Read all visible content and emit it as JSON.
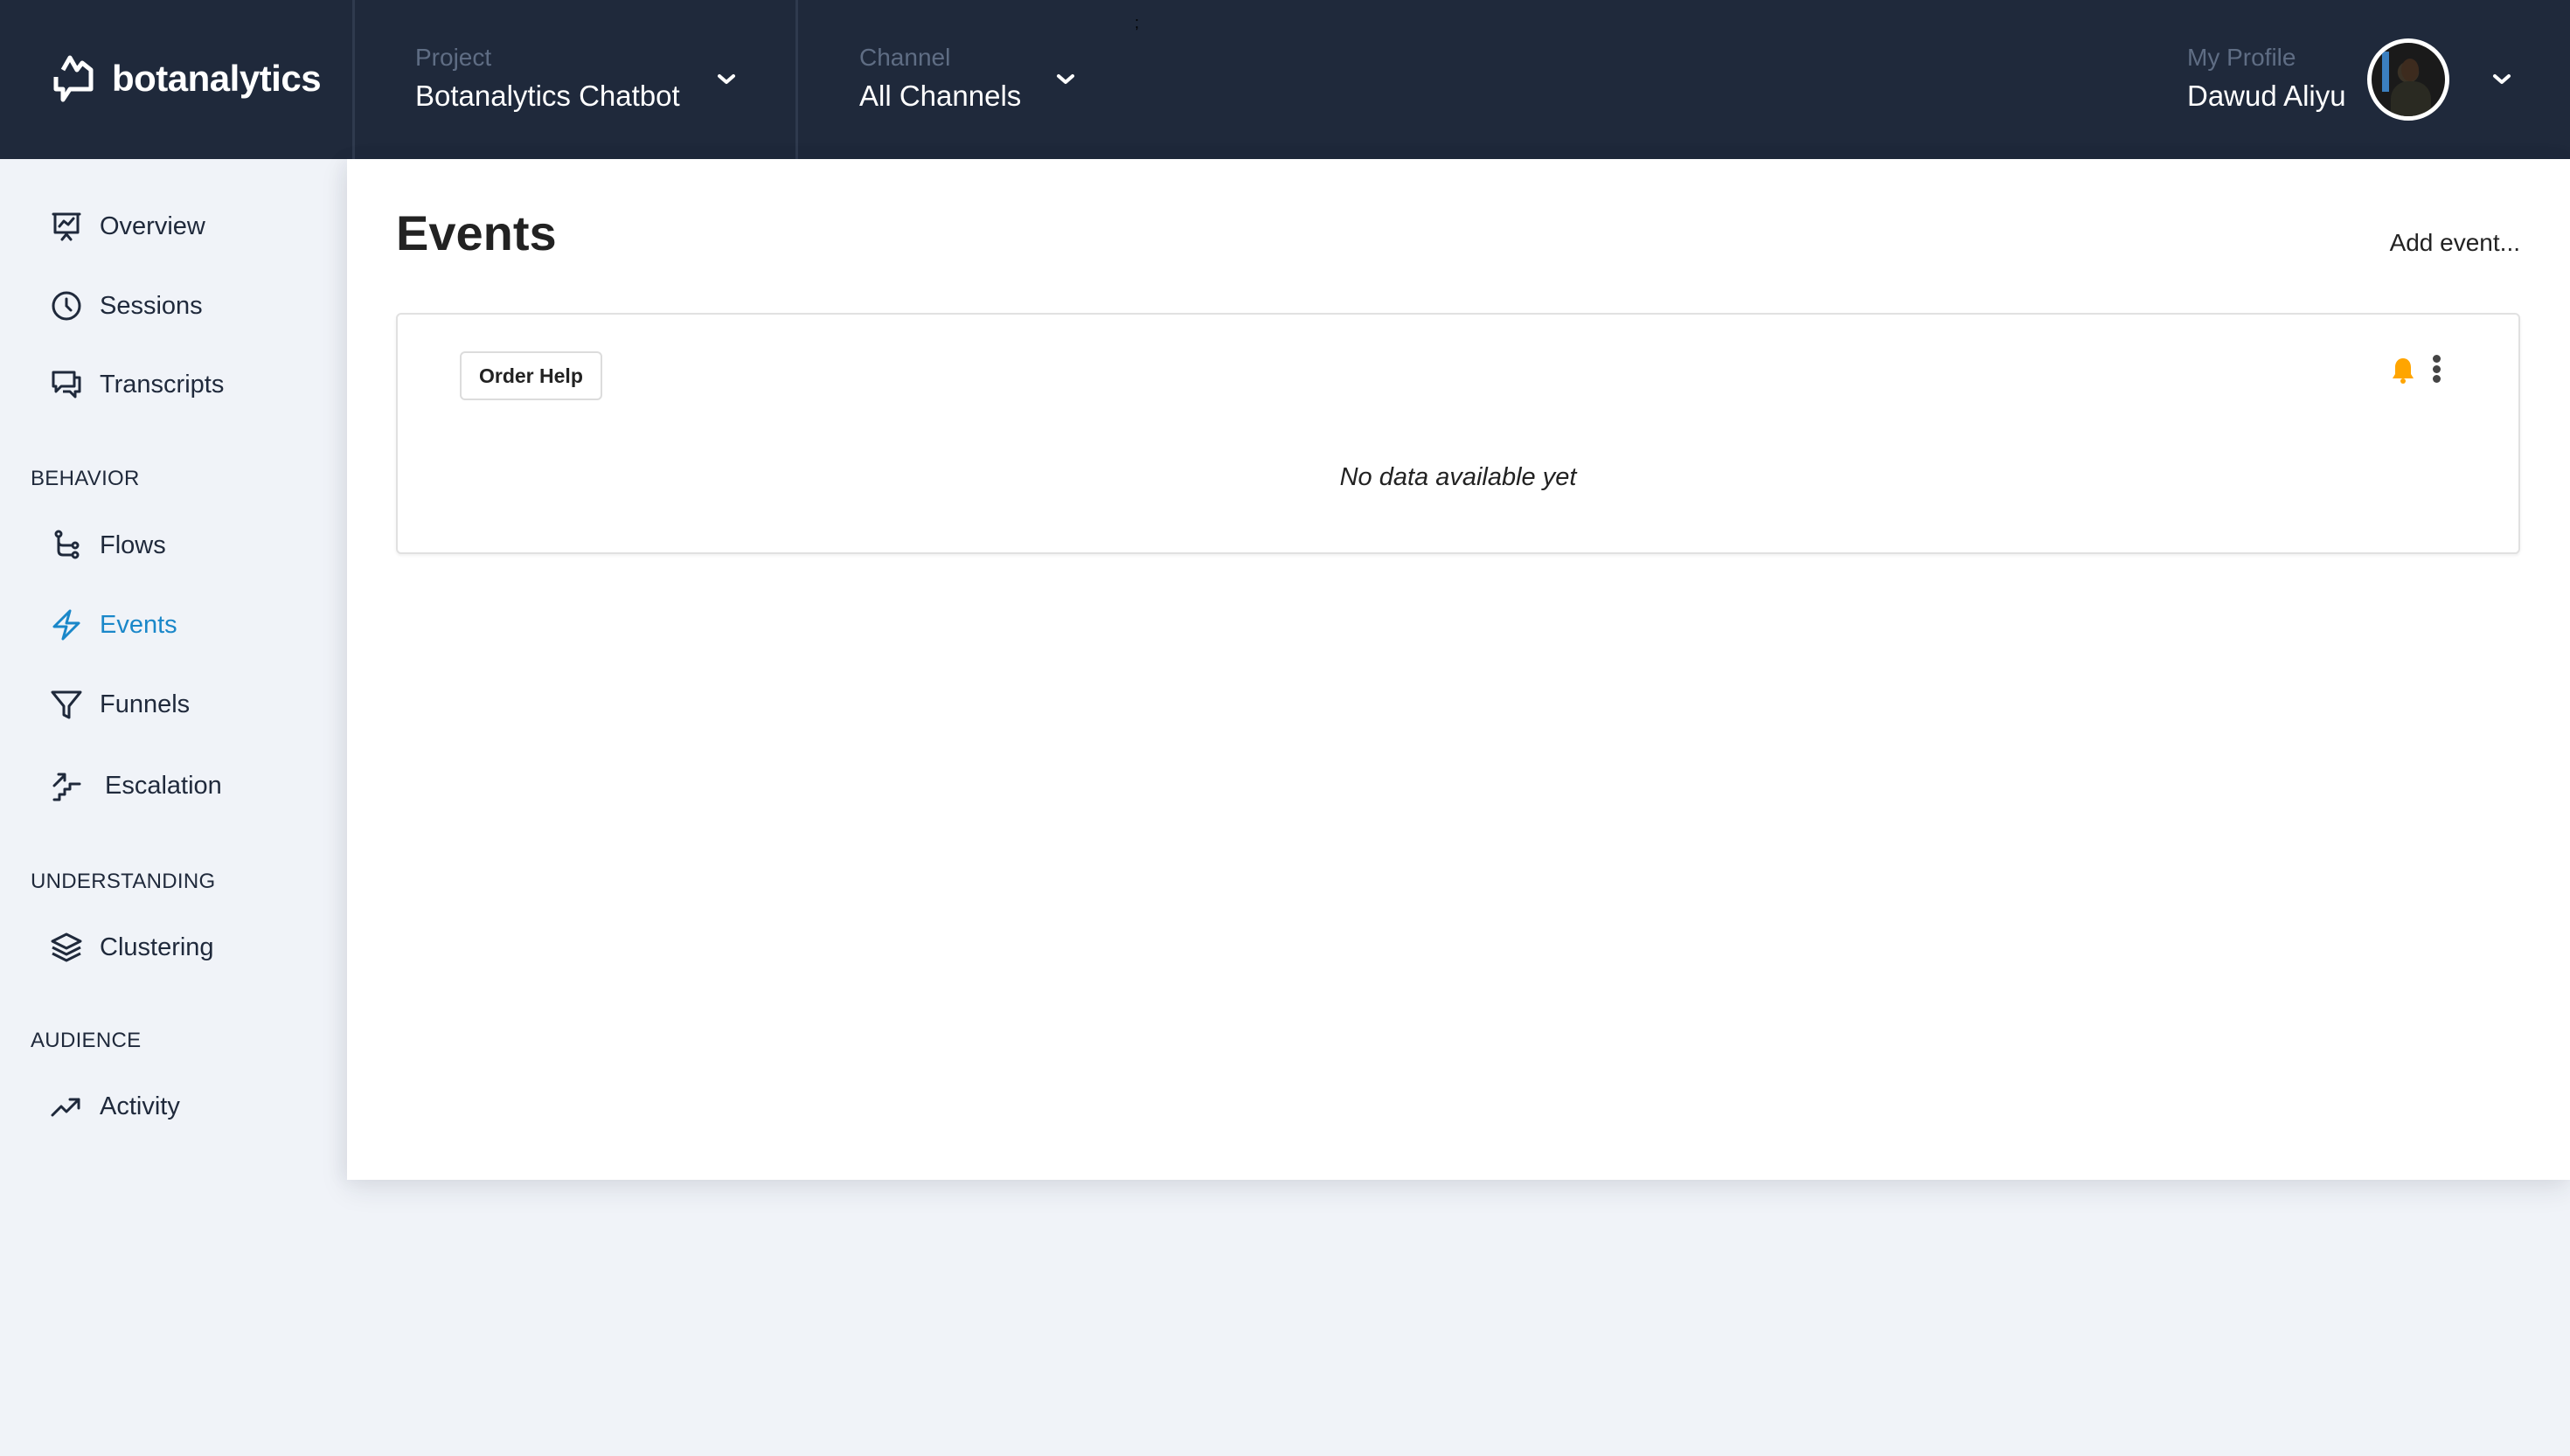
{
  "header": {
    "brand": "botanalytics",
    "project": {
      "label": "Project",
      "value": "Botanalytics Chatbot"
    },
    "channel": {
      "label": "Channel",
      "value": "All Channels"
    },
    "profile": {
      "label": "My Profile",
      "name": "Dawud Aliyu"
    },
    "artifact": ";"
  },
  "sidebar": {
    "items": [
      {
        "label": "Overview",
        "icon": "presentation-chart-icon"
      },
      {
        "label": "Sessions",
        "icon": "clock-icon"
      },
      {
        "label": "Transcripts",
        "icon": "chat-bubbles-icon"
      }
    ],
    "sections": [
      {
        "title": "BEHAVIOR",
        "items": [
          {
            "label": "Flows",
            "icon": "flow-branch-icon"
          },
          {
            "label": "Events",
            "icon": "lightning-icon",
            "active": true
          },
          {
            "label": "Funnels",
            "icon": "funnel-icon"
          },
          {
            "label": "Escalation",
            "icon": "stairs-arrow-icon"
          }
        ]
      },
      {
        "title": "UNDERSTANDING",
        "items": [
          {
            "label": "Clustering",
            "icon": "layers-icon"
          }
        ]
      },
      {
        "title": "AUDIENCE",
        "items": [
          {
            "label": "Activity",
            "icon": "trending-up-icon"
          }
        ]
      }
    ]
  },
  "main": {
    "title": "Events",
    "add_event_label": "Add event...",
    "cards": [
      {
        "event_name": "Order Help",
        "empty_message": "No data available yet",
        "alert_icon": "bell-icon",
        "menu_icon": "kebab-menu-icon"
      }
    ]
  },
  "colors": {
    "header_bg": "#1f293b",
    "sidebar_bg": "#f0f3f8",
    "active_nav": "#1a87c9",
    "bell": "#ffa500",
    "muted_label": "#5f6d84"
  }
}
